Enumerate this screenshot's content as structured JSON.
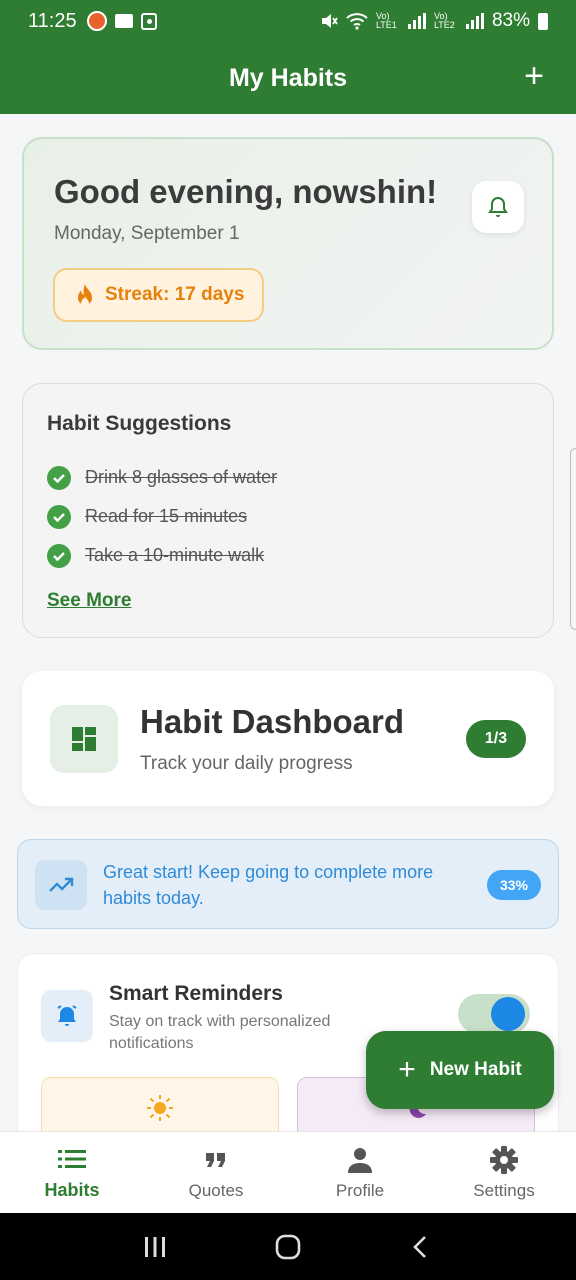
{
  "status_bar": {
    "time": "11:25",
    "network_1": "Vo) LTE1",
    "network_2": "Vo) LTE2",
    "battery": "83%"
  },
  "app_bar": {
    "title": "My Habits",
    "add_label": "+"
  },
  "greeting": {
    "title": "Good evening, nowshin!",
    "date": "Monday, September 1",
    "streak": "Streak: 17 days"
  },
  "suggestions": {
    "title": "Habit Suggestions",
    "items": [
      {
        "label": "Drink 8 glasses of water",
        "done": true
      },
      {
        "label": "Read for 15 minutes",
        "done": true
      },
      {
        "label": "Take a 10-minute walk",
        "done": true
      }
    ],
    "see_more": "See More"
  },
  "dashboard": {
    "title": "Habit Dashboard",
    "subtitle": "Track your daily progress",
    "count": "1/3"
  },
  "progress_banner": {
    "message": "Great start! Keep going to complete more habits today.",
    "percent": "33%",
    "progress_fraction": 0.33
  },
  "reminders": {
    "title": "Smart Reminders",
    "description": "Stay on track with personalized notifications",
    "enabled": true
  },
  "fab": {
    "plus": "+",
    "label": "New Habit"
  },
  "bottom_nav": {
    "items": [
      {
        "label": "Habits",
        "icon": "list-icon",
        "active": true
      },
      {
        "label": "Quotes",
        "icon": "quote-icon",
        "active": false
      },
      {
        "label": "Profile",
        "icon": "person-icon",
        "active": false
      },
      {
        "label": "Settings",
        "icon": "gear-icon",
        "active": false
      }
    ]
  },
  "colors": {
    "primary": "#2e7d32",
    "accent_blue": "#1e88e5",
    "streak_orange": "#e8810b",
    "check_green": "#43a047"
  }
}
